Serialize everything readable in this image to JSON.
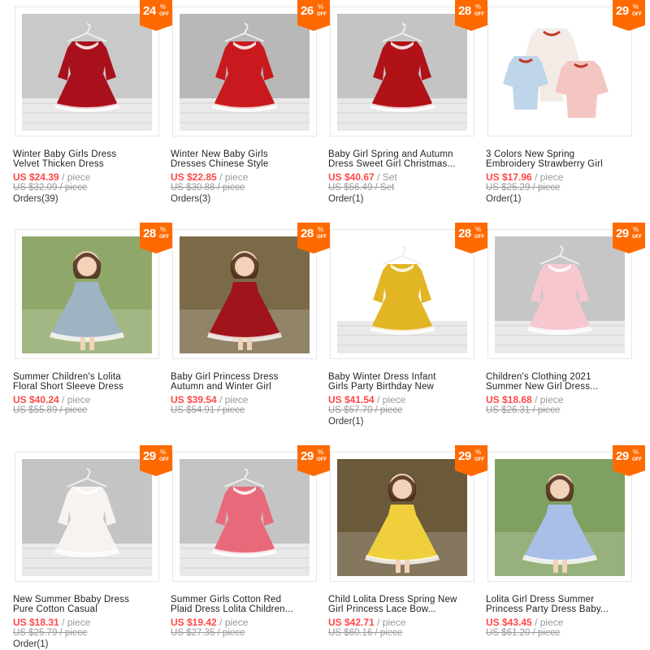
{
  "products": [
    {
      "title": "Winter Baby Girls Dress\nVelvet Thicken Dress",
      "price": "US $24.39",
      "unit": "/ piece",
      "original": "US $32.09 / piece",
      "orders": "Orders(39)",
      "discount": "24",
      "dress": "#a8101c",
      "bg": "#c9c9c9",
      "type": "hanger"
    },
    {
      "title": "Winter New Baby Girls\nDresses Chinese Style",
      "price": "US $22.85",
      "unit": "/ piece",
      "original": "US $30.88 / piece",
      "orders": "Orders(3)",
      "discount": "26",
      "dress": "#c81a1e",
      "bg": "#b8b8b8",
      "type": "hanger"
    },
    {
      "title": "Baby Girl Spring and Autumn\nDress Sweet Girl Christmas...",
      "price": "US $40.67",
      "unit": "/ Set",
      "original": "US $56.49 / Set",
      "orders": "Order(1)",
      "discount": "28",
      "dress": "#b01218",
      "bg": "#c4c4c4",
      "type": "hanger"
    },
    {
      "title": "3 Colors New Spring\nEmbroidery Strawberry Girl",
      "price": "US $17.96",
      "unit": "/ piece",
      "original": "US $25.29 / piece",
      "orders": "Order(1)",
      "discount": "29",
      "dress": "#f4c6c2",
      "bg": "#ffffff",
      "type": "trio"
    },
    {
      "title": "Summer Children's Lolita\nFloral Short Sleeve Dress",
      "price": "US $40.24",
      "unit": "/ piece",
      "original": "US $55.89 / piece",
      "orders": "",
      "discount": "28",
      "dress": "#9fb4c2",
      "bg": "#8fa86a",
      "type": "girl"
    },
    {
      "title": "Baby Girl Princess Dress\nAutumn and Winter Girl",
      "price": "US $39.54",
      "unit": "/ piece",
      "original": "US $54.91 / piece",
      "orders": "",
      "discount": "28",
      "dress": "#a0141c",
      "bg": "#7b6a48",
      "type": "girl"
    },
    {
      "title": "Baby Winter Dress Infant\nGirls Party Birthday New",
      "price": "US $41.54",
      "unit": "/ piece",
      "original": "US $57.70 / piece",
      "orders": "Order(1)",
      "discount": "28",
      "dress": "#e2b525",
      "bg": "#ffffff",
      "type": "hanger"
    },
    {
      "title": "Children's Clothing 2021\nSummer New Girl Dress...",
      "price": "US $18.68",
      "unit": "/ piece",
      "original": "US $26.31 / piece",
      "orders": "",
      "discount": "29",
      "dress": "#f6c7cf",
      "bg": "#c6c6c6",
      "type": "hanger"
    },
    {
      "title": "New Summer Bbaby Dress\nPure Cotton Casual",
      "price": "US $18.31",
      "unit": "/ piece",
      "original": "US $25.79 / piece",
      "orders": "Order(1)",
      "discount": "29",
      "dress": "#f7f3f0",
      "bg": "#c4c4c4",
      "type": "hanger"
    },
    {
      "title": "Summer Girls Cotton Red\nPlaid Dress Lolita Children...",
      "price": "US $19.42",
      "unit": "/ piece",
      "original": "US $27.35 / piece",
      "orders": "",
      "discount": "29",
      "dress": "#e86a7a",
      "bg": "#c4c4c4",
      "type": "hanger"
    },
    {
      "title": "Child Lolita Dress Spring New\nGirl Princess Lace Bow...",
      "price": "US $42.71",
      "unit": "/ piece",
      "original": "US $60.16 / piece",
      "orders": "",
      "discount": "29",
      "dress": "#f0cf3c",
      "bg": "#6a5a3a",
      "type": "girl"
    },
    {
      "title": "Lolita Girl Dress Summer\nPrincess Party Dress Baby...",
      "price": "US $43.45",
      "unit": "/ piece",
      "original": "US $61.20 / piece",
      "orders": "",
      "discount": "29",
      "dress": "#a9bfe8",
      "bg": "#7fa060",
      "type": "girl"
    }
  ],
  "badge": {
    "symbol": "%",
    "off": "OFF"
  },
  "colors": {
    "accent": "#ff6a00",
    "price": "#ff4747",
    "muted": "#999999"
  }
}
